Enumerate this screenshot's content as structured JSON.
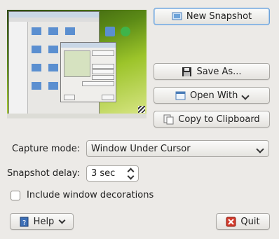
{
  "buttons": {
    "new_snapshot": "New Snapshot",
    "save_as": "Save As...",
    "open_with": "Open With",
    "copy_clipboard": "Copy to Clipboard",
    "help": "Help",
    "quit": "Quit"
  },
  "capture_mode": {
    "label": "Capture mode:",
    "value": "Window Under Cursor"
  },
  "snapshot_delay": {
    "label": "Snapshot delay:",
    "value": "3 sec"
  },
  "include_decorations": {
    "label": "Include window decorations",
    "checked": false
  },
  "icons": {
    "new_snapshot": "camera-screen-icon",
    "save_as": "floppy-disk-icon",
    "open_with": "open-with-icon",
    "copy": "clipboard-copy-icon",
    "help": "help-book-icon",
    "quit": "quit-icon"
  }
}
